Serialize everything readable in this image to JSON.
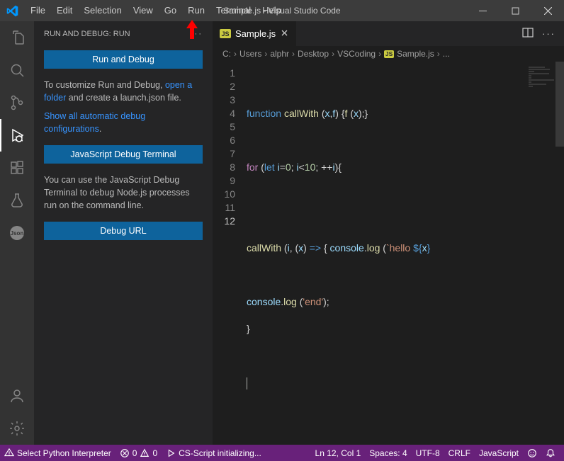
{
  "titlebar": {
    "menu": [
      "File",
      "Edit",
      "Selection",
      "View",
      "Go",
      "Run",
      "Terminal",
      "Help"
    ],
    "title": "Sample.js - Visual Studio Code"
  },
  "sidebar": {
    "title": "RUN AND DEBUG: RUN",
    "runDebug": "Run and Debug",
    "customizeText": "To customize Run and Debug, ",
    "openFolder": "open a folder",
    "createLaunch": " and create a launch.json file.",
    "showAuto": "Show all automatic debug configurations",
    "period": ".",
    "jsDebugTerminal": "JavaScript Debug Terminal",
    "jsUseText": "You can use the JavaScript Debug Terminal to debug Node.js processes run on the command line.",
    "debugUrl": "Debug URL"
  },
  "tab": {
    "badge": "JS",
    "name": "Sample.js"
  },
  "breadcrumb": {
    "parts": [
      "C:",
      "Users",
      "alphr",
      "Desktop",
      "VSCoding"
    ],
    "fileBadge": "JS",
    "file": "Sample.js",
    "trail": "..."
  },
  "code": {
    "lines": 12
  },
  "statusbar": {
    "pyInterp": "Select Python Interpreter",
    "err0": "0",
    "warn0": "0",
    "csScript": "CS-Script initializing...",
    "lnCol": "Ln 12, Col 1",
    "spaces": "Spaces: 4",
    "encoding": "UTF-8",
    "eol": "CRLF",
    "lang": "JavaScript"
  }
}
